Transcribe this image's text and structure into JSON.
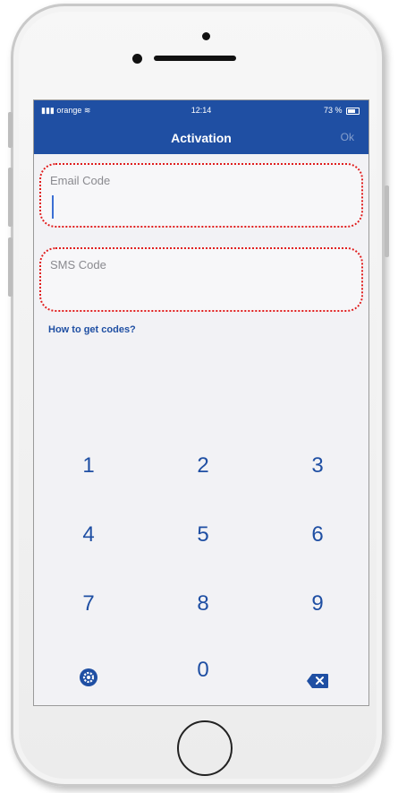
{
  "status_bar": {
    "carrier": "orange",
    "time": "12:14",
    "battery": "73 %"
  },
  "nav": {
    "title": "Activation",
    "ok_label": "Ok"
  },
  "fields": {
    "email": {
      "label": "Email Code",
      "value": ""
    },
    "sms": {
      "label": "SMS Code",
      "value": ""
    }
  },
  "help_link": "How to get codes?",
  "keypad": {
    "keys": [
      "1",
      "2",
      "3",
      "4",
      "5",
      "6",
      "7",
      "8",
      "9",
      "0"
    ],
    "settings_icon": "gear-icon",
    "delete_icon": "backspace-icon"
  },
  "colors": {
    "brand": "#1f4fa3",
    "highlight": "#e01e1e"
  }
}
